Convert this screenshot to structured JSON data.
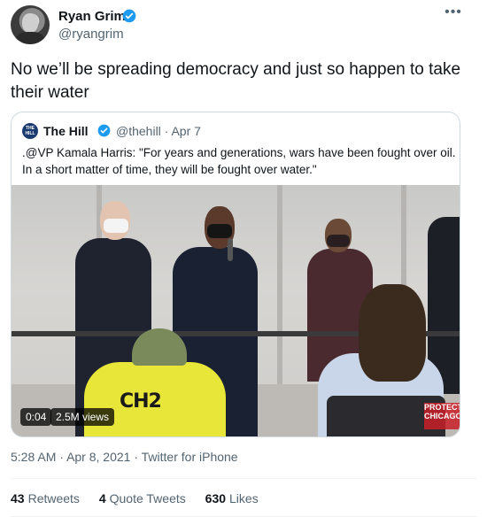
{
  "author": {
    "name": "Ryan Grim",
    "handle": "@ryangrim",
    "avatar_icon": "user-avatar"
  },
  "tweet": {
    "text": "No we’ll be spreading democracy and just so happen to take their water",
    "more_icon": "more-horizontal-icon"
  },
  "quote": {
    "name": "The Hill",
    "handle": "@thehill · Apr 7",
    "avatar_text": "THE HILL",
    "text": ".@VP Kamala Harris: \"For years and generations, wars have been fought over oil. In a short matter of time, they will be fought over water.\"",
    "video": {
      "duration": "0:04",
      "views": "2.5M views",
      "vest_text": "CH2",
      "watermark": "PROTECT CHICAGO"
    }
  },
  "meta": {
    "time": "5:28 AM",
    "date": "Apr 8, 2021",
    "source": "Twitter for iPhone",
    "sep": "·"
  },
  "stats": {
    "retweets_count": "43",
    "retweets_label": "Retweets",
    "quotes_count": "4",
    "quotes_label": "Quote Tweets",
    "likes_count": "630",
    "likes_label": "Likes"
  },
  "colors": {
    "verified": "#1d9bf0",
    "secondary_text": "#536471",
    "primary_text": "#0f1419"
  }
}
